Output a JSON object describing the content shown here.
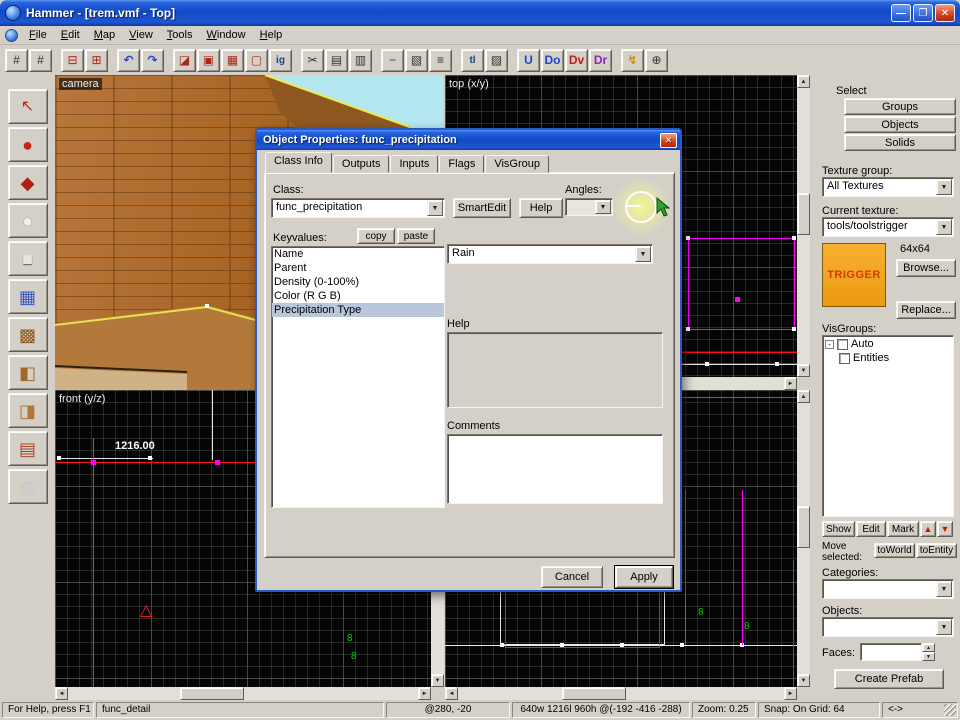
{
  "colors": {
    "titlebar_blue": "#1249c4",
    "chrome_gray": "#d4d0c8",
    "viewport_bg": "#050505",
    "grid_minor": "#4b554b",
    "grid_major": "#828c82",
    "selection_magenta": "#ff00ff",
    "wire_red": "#ff1410",
    "wire_white": "#e8e8e8",
    "entity_green": "#00cc00",
    "texture_orange": "#f0a420",
    "trigger_text": "#d43c00",
    "highlight_yellow": "#f4fa8c",
    "sky_cyan": "#b4e7ef",
    "wall_orange": "#a5611f"
  },
  "window": {
    "title": "Hammer - [trem.vmf - Top]",
    "minimize": "—",
    "maximize": "❐",
    "close": "✕"
  },
  "menubar": {
    "items": [
      "File",
      "Edit",
      "Map",
      "View",
      "Tools",
      "Window",
      "Help"
    ]
  },
  "toolbar": {
    "buttons": [
      {
        "name": "toggle-grid",
        "glyph": "#"
      },
      {
        "name": "toggle-3d-grid",
        "glyph": "#"
      },
      {
        "name": "smaller-grid",
        "glyph": "⊟"
      },
      {
        "name": "larger-grid",
        "glyph": "⊞"
      },
      {
        "name": "undo",
        "glyph": "↶"
      },
      {
        "name": "redo",
        "glyph": "↷"
      },
      {
        "name": "carve",
        "glyph": "◪"
      },
      {
        "name": "make-hollow",
        "glyph": "▣"
      },
      {
        "name": "group",
        "glyph": "▦"
      },
      {
        "name": "ungroup",
        "glyph": "▢"
      },
      {
        "name": "ignore-groups",
        "glyph": "ig"
      },
      {
        "name": "cut",
        "glyph": "✂"
      },
      {
        "name": "copy",
        "glyph": "▤"
      },
      {
        "name": "paste",
        "glyph": "▥"
      },
      {
        "name": "hide-selected",
        "glyph": "−"
      },
      {
        "name": "hide-unselected",
        "glyph": "▧"
      },
      {
        "name": "show-all",
        "glyph": "≡"
      },
      {
        "name": "texture-lock",
        "glyph": "tl"
      },
      {
        "name": "texture-application",
        "glyph": "▨"
      },
      {
        "name": "displacement-mask",
        "glyph": "U"
      },
      {
        "name": "entity-report",
        "glyph": "Do"
      },
      {
        "name": "entity-filter",
        "glyph": "Dv"
      },
      {
        "name": "overlay-filter",
        "glyph": "Dr"
      },
      {
        "name": "run-map",
        "glyph": "↯"
      },
      {
        "name": "pointer-mode",
        "glyph": "⊕"
      }
    ]
  },
  "tool_palette": {
    "tools": [
      {
        "name": "selection-tool",
        "glyph": "↖"
      },
      {
        "name": "magnify-tool",
        "glyph": "●"
      },
      {
        "name": "camera-tool",
        "glyph": "◆"
      },
      {
        "name": "entity-tool",
        "glyph": "●"
      },
      {
        "name": "block-tool",
        "glyph": "■"
      },
      {
        "name": "texture-application-tool",
        "glyph": "▦"
      },
      {
        "name": "apply-current-texture-tool",
        "glyph": "▩"
      },
      {
        "name": "apply-decals-tool",
        "glyph": "◧"
      },
      {
        "name": "apply-overlays-tool",
        "glyph": "◨"
      },
      {
        "name": "clipping-tool",
        "glyph": "▤"
      },
      {
        "name": "vertex-manipulation-tool",
        "glyph": "◍"
      }
    ]
  },
  "viewports": {
    "camera_label": "camera",
    "top_label": "top (x/y)",
    "front_label": "front (y/z)",
    "front_dimension": "1216.00",
    "marker_glyph": "8",
    "triangle_glyph": "△"
  },
  "glyphs": {
    "up": "▲",
    "down": "▼",
    "left": "◄",
    "right": "►",
    "minus": "-",
    "combo_arrow": "▼"
  },
  "dialog": {
    "title": "Object Properties: func_precipitation",
    "close": "✕",
    "tabs": [
      "Class Info",
      "Outputs",
      "Inputs",
      "Flags",
      "VisGroup"
    ],
    "class_label": "Class:",
    "class_value": "func_precipitation",
    "smartedit_button": "SmartEdit",
    "help_button": "Help",
    "angles_label": "Angles:",
    "keyvalues_label": "Keyvalues:",
    "copy_button": "copy",
    "paste_button": "paste",
    "keyvalues": [
      "Name",
      "Parent",
      "Density (0-100%)",
      "Color (R G B)",
      "Precipitation Type"
    ],
    "value_combo": "Rain",
    "help_section_label": "Help",
    "comments_label": "Comments",
    "cancel_button": "Cancel",
    "apply_button": "Apply"
  },
  "right_panel": {
    "select_label": "Select",
    "groups_button": "Groups",
    "objects_button": "Objects",
    "solids_button": "Solids",
    "texture_group_label": "Texture group:",
    "texture_group_value": "All Textures",
    "current_texture_label": "Current texture:",
    "current_texture_value": "tools/toolstrigger",
    "texture_preview_text": "TRIGGER",
    "texture_size": "64x64",
    "browse_button": "Browse...",
    "replace_button": "Replace...",
    "visgroups_label": "VisGroups:",
    "visgroup_root": "Auto",
    "visgroup_child": "Entities",
    "show_button": "Show",
    "edit_button": "Edit",
    "mark_button": "Mark",
    "move_selected_label": "Move selected:",
    "toworld_button": "toWorld",
    "toentity_button": "toEntity",
    "categories_label": "Categories:",
    "objects_label": "Objects:",
    "faces_label": "Faces:",
    "create_prefab_button": "Create Prefab"
  },
  "statusbar": {
    "segments": [
      "For Help, press F1",
      "func_detail",
      "@280, -20",
      "640w 1216l 960h @(-192 -416 -288)",
      "Zoom: 0.25",
      "Snap: On Grid: 64",
      "<->"
    ]
  }
}
